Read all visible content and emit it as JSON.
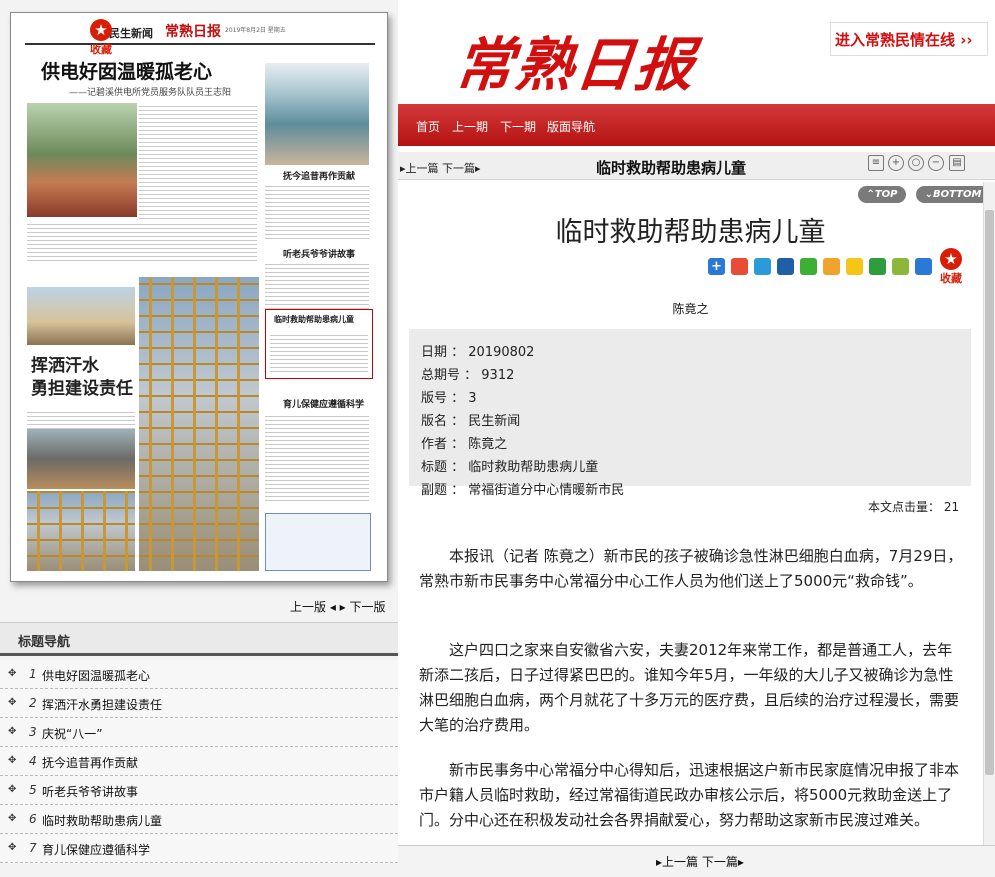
{
  "newspaper": {
    "edition_label": "民生新闻",
    "mini_logo": "常熟日报",
    "headline": "供电好囡温暖孤老心",
    "subheadline": "——记碧溪供电所党员服务队队员王志阳",
    "big_caption": "挥洒汗水\n勇担建设责任",
    "section_titles": [
      "抚今追昔再作贡献",
      "听老兵爷爷讲故事",
      "临时救助帮助患病儿童",
      "育儿保健应遵循科学"
    ],
    "fav_label": "收藏"
  },
  "page_nav": {
    "prev": "上一版",
    "next": "下一版"
  },
  "title_nav": {
    "header": "标题导航",
    "items": [
      {
        "num": "1",
        "title": "供电好囡温暖孤老心"
      },
      {
        "num": "2",
        "title": "挥洒汗水勇担建设责任"
      },
      {
        "num": "3",
        "title": "庆祝“八一”"
      },
      {
        "num": "4",
        "title": "抚今追昔再作贡献"
      },
      {
        "num": "5",
        "title": "听老兵爷爷讲故事"
      },
      {
        "num": "6",
        "title": "临时救助帮助患病儿童"
      },
      {
        "num": "7",
        "title": "育儿保健应遵循科学"
      }
    ]
  },
  "masthead": {
    "logo": "常熟日报",
    "promo": "进入常熟民情在线 ››",
    "menu": [
      "首页",
      "上一期",
      "下一期",
      "版面导航"
    ]
  },
  "toolbar": {
    "prevnext": "▸上一篇 下一篇▸",
    "title": "临时救助帮助患病儿童",
    "top_label": "⌃TOP",
    "bottom_label": "⌄BOTTOM"
  },
  "article": {
    "title": "临时救助帮助患病儿童",
    "author": "陈竟之",
    "fav_label": "收藏",
    "meta": [
      {
        "key": "日期",
        "value": "20190802"
      },
      {
        "key": "总期号",
        "value": "9312"
      },
      {
        "key": "版号",
        "value": "3"
      },
      {
        "key": "版名",
        "value": "民生新闻"
      },
      {
        "key": "作者",
        "value": "陈竟之"
      },
      {
        "key": "标题",
        "value": "临时救助帮助患病儿童"
      },
      {
        "key": "副题",
        "value": "常福街道分中心情暖新市民"
      }
    ],
    "hits_label": "本文点击量：",
    "hits_value": "21",
    "paragraphs": [
      "本报讯（记者 陈竟之）新市民的孩子被确诊急性淋巴细胞白血病，7月29日，常熟市新市民事务中心常福分中心工作人员为他们送上了5000元“救命钱”。",
      "这户四口之家来自安徽省六安，夫妻2012年来常工作，都是普通工人，去年新添二孩后，日子过得紧巴巴的。谁知今年5月，一年级的大儿子又被确诊为急性淋巴细胞白血病，两个月就花了十多万元的医疗费，且后续的治疗过程漫长，需要大笔的治疗费用。",
      "新市民事务中心常福分中心得知后，迅速根据这户新市民家庭情况申报了非本市户籍人员临时救助，经过常福街道民政办审核公示后，将5000元救助金送上了门。分中心还在积极发动社会各界捐献爱心，努力帮助这家新市民渡过难关。"
    ]
  },
  "bottom_nav": "▸上一篇 下一篇▸",
  "colors": {
    "brand_red": "#d20f0f",
    "menu_red": "#c42424"
  },
  "share_icons": [
    "plus-icon",
    "weibo-icon",
    "qzone-icon",
    "renren-icon",
    "wechat-icon",
    "tencent-weibo-icon",
    "star-icon",
    "douban-icon",
    "kaixin-icon",
    "info-icon"
  ]
}
